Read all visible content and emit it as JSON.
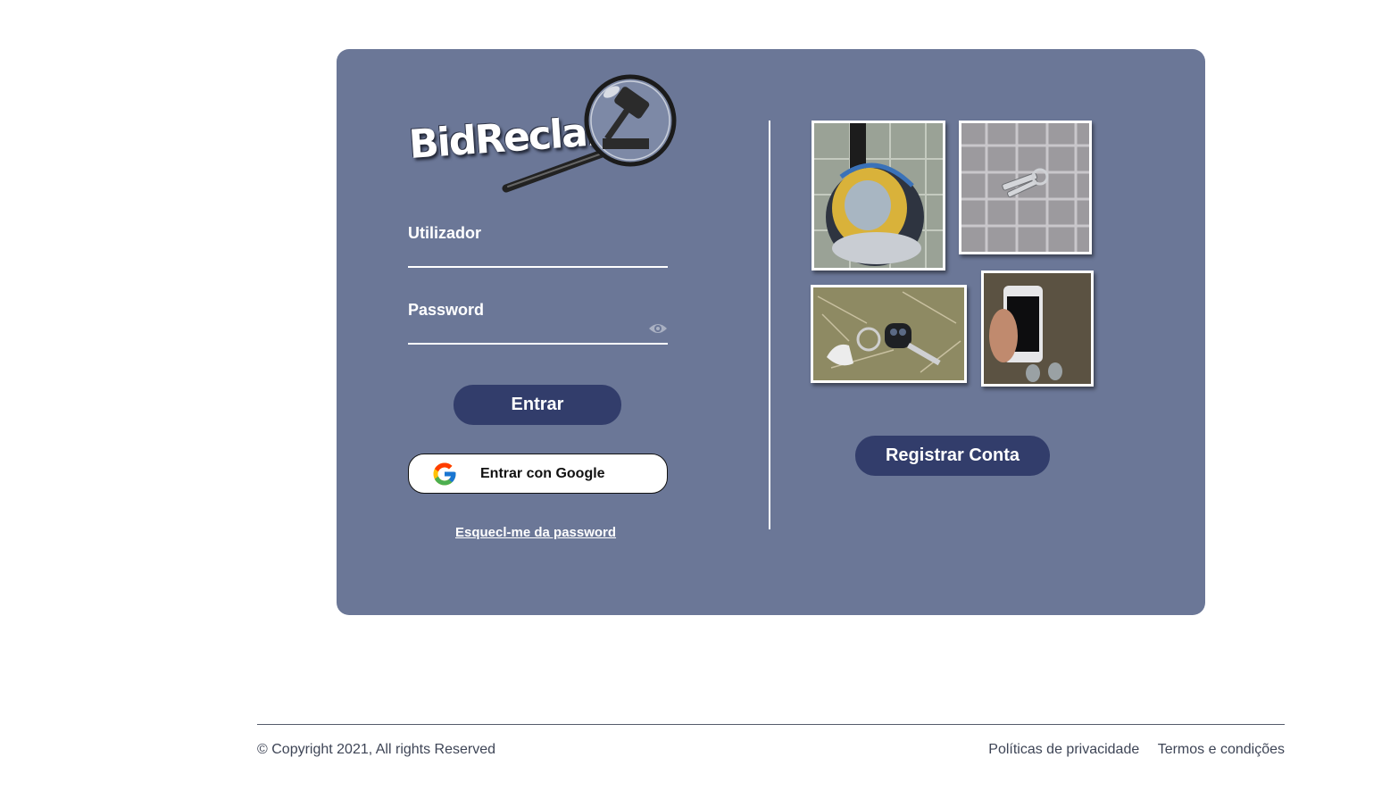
{
  "logo": {
    "text": "BidReclaim"
  },
  "login": {
    "username_label": "Utilizador",
    "password_label": "Password",
    "submit_label": "Entrar",
    "google_label": "Entrar con Google",
    "forgot_label": "Esquecl-me da password"
  },
  "register": {
    "button_label": "Registrar Conta"
  },
  "footer": {
    "copyright": "© Copyright 2021, All rights Reserved",
    "privacy": "Políticas de privacidade",
    "terms": "Termos e condições"
  },
  "colors": {
    "card": "#6b7797",
    "button": "#323d6b",
    "text_light": "#ffffff"
  },
  "icons": [
    "magnifier-gavel-icon",
    "eye-icon",
    "google-icon"
  ]
}
